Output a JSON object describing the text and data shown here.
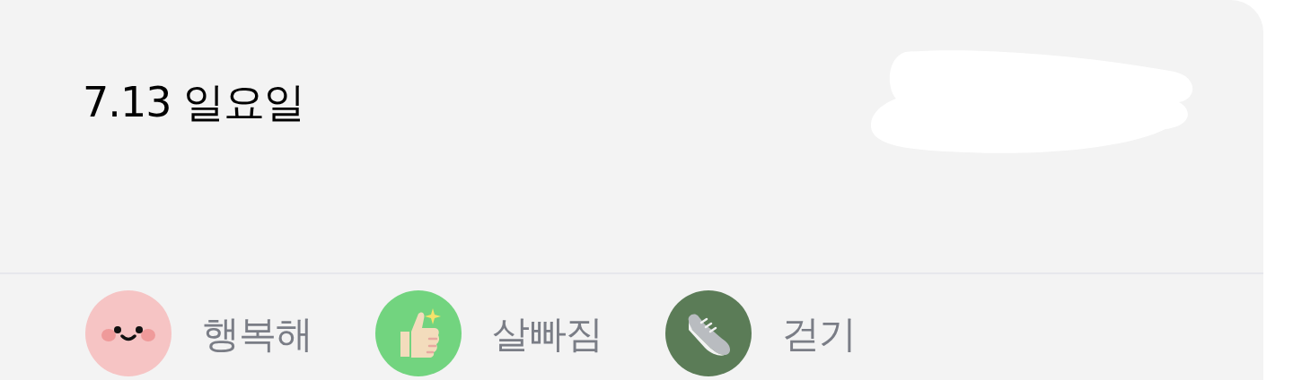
{
  "entry": {
    "date": "7.13 일요일"
  },
  "tags": [
    {
      "kind": "face",
      "label": "행복해",
      "color": "#f6c4c4"
    },
    {
      "kind": "thumbs",
      "label": "살빠짐",
      "color": "#72d47f"
    },
    {
      "kind": "shoe",
      "label": "걷기",
      "color": "#5b7c57"
    }
  ]
}
